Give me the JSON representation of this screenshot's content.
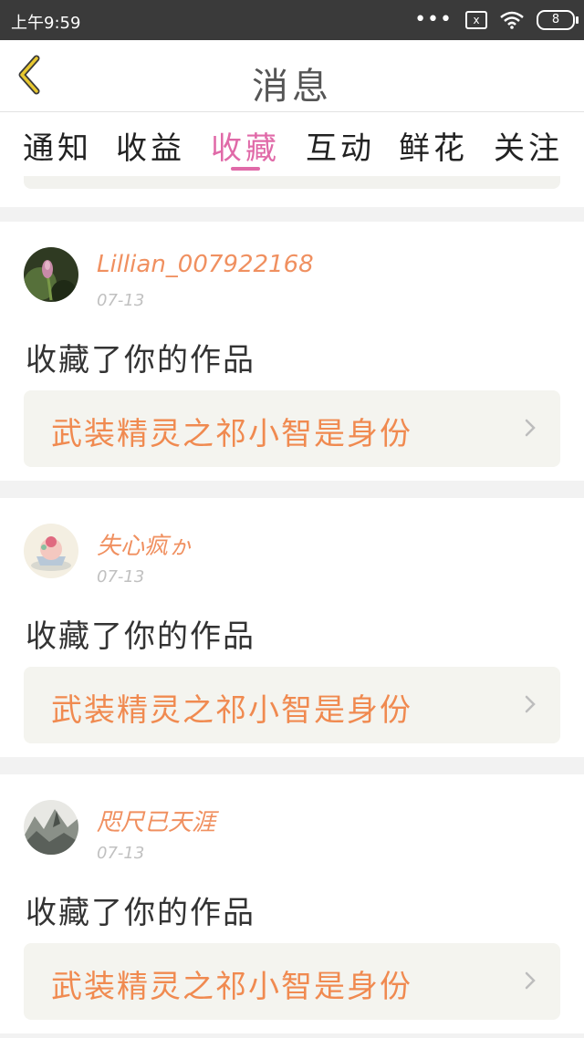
{
  "status_bar": {
    "time": "上午9:59",
    "signal_glyph": "x",
    "battery_level": "8"
  },
  "header": {
    "title": "消息"
  },
  "tabs": [
    {
      "label": "通知",
      "active": false
    },
    {
      "label": "收益",
      "active": false
    },
    {
      "label": "收藏",
      "active": true
    },
    {
      "label": "互动",
      "active": false
    },
    {
      "label": "鲜花",
      "active": false
    },
    {
      "label": "关注",
      "active": false
    }
  ],
  "colors": {
    "accent_pink": "#e06aa8",
    "username_orange": "#f09060",
    "work_title_orange": "#f08a50"
  },
  "notifications": [
    {
      "username": "Lillian_007922168",
      "date": "07-13",
      "action": "收藏了你的作品",
      "work_title": "武装精灵之祁小智是身份",
      "avatar_icon": "flower-bud-avatar"
    },
    {
      "username": "失心疯ゕ",
      "date": "07-13",
      "action": "收藏了你的作品",
      "work_title": "武装精灵之祁小智是身份",
      "avatar_icon": "cupcake-avatar"
    },
    {
      "username": "咫尺已天涯",
      "date": "07-13",
      "action": "收藏了你的作品",
      "work_title": "武装精灵之祁小智是身份",
      "avatar_icon": "landscape-painting-avatar"
    }
  ]
}
